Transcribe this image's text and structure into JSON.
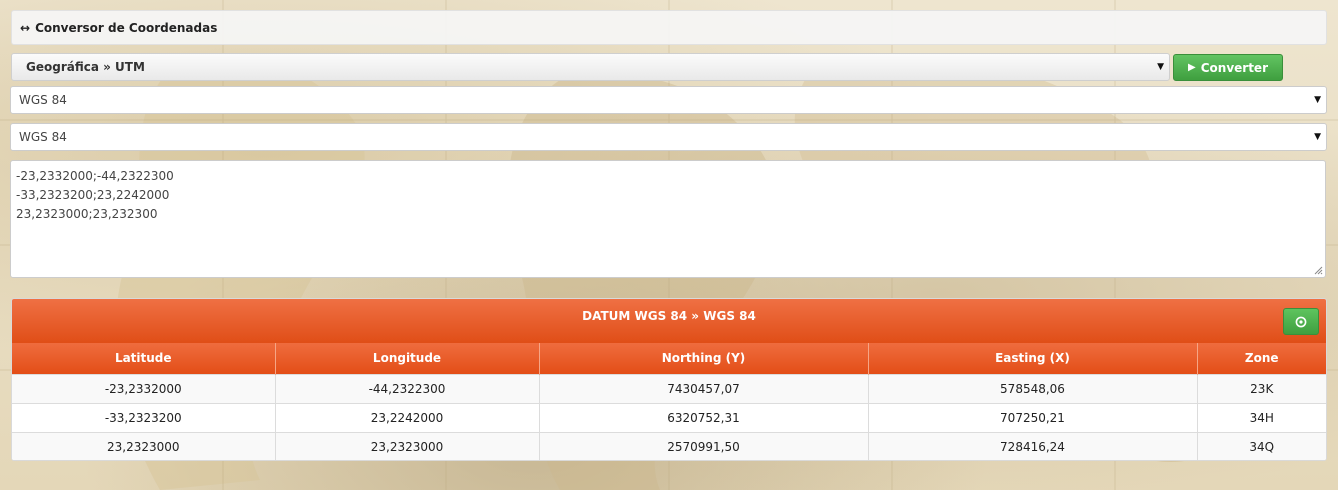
{
  "panel": {
    "title": "Conversor de Coordenadas",
    "icon": "left-right-arrow-icon"
  },
  "conversion": {
    "mode_value": "Geográfica » UTM",
    "convert_label": "Converter"
  },
  "datum_from": {
    "value": "WGS 84"
  },
  "datum_to": {
    "value": "WGS 84"
  },
  "input": {
    "lines": [
      "-23,2332000;-44,2322300",
      "-33,2323200;23,2242000",
      "23,2323000;23,232300"
    ]
  },
  "results": {
    "title": "DATUM WGS 84 » WGS 84",
    "refresh_icon": "refresh-circle-icon",
    "columns": [
      "Latitude",
      "Longitude",
      "Northing (Y)",
      "Easting (X)",
      "Zone"
    ],
    "rows": [
      [
        "-23,2332000",
        "-44,2322300",
        "7430457,07",
        "578548,06",
        "23K"
      ],
      [
        "-33,2323200",
        "23,2242000",
        "6320752,31",
        "707250,21",
        "34H"
      ],
      [
        "23,2323000",
        "23,2323000",
        "2570991,50",
        "728416,24",
        "34Q"
      ]
    ]
  },
  "colors": {
    "accent_orange": "#e04e17",
    "success_green": "#4cae4c"
  }
}
